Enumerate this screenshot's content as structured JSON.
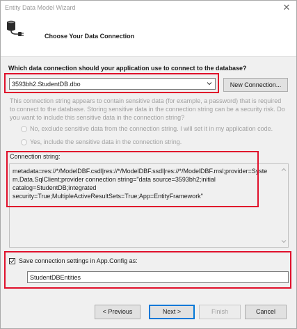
{
  "window": {
    "title": "Entity Data Model Wizard",
    "close_glyph": "✕"
  },
  "header": {
    "title": "Choose Your Data Connection",
    "icon": "database-plug-icon"
  },
  "question": "Which data connection should your application use to connect to the database?",
  "connection": {
    "selected": "3593bh2.StudentDB.dbo",
    "new_button": "New Connection..."
  },
  "sensitive": {
    "text": "This connection string appears to contain sensitive data (for example, a password) that is required to connect to the database. Storing sensitive data in the connection string can be a security risk. Do you want to include this sensitive data in the connection string?",
    "option_no": "No, exclude sensitive data from the connection string. I will set it in my application code.",
    "option_yes": "Yes, include the sensitive data in the connection string."
  },
  "conn_string": {
    "label": "Connection string:",
    "value": "metadata=res://*/ModelDBF.csdl|res://*/ModelDBF.ssdl|res://*/ModelDBF.msl;provider=System.Data.SqlClient;provider connection string=\"data source=3593bh2;initial catalog=StudentDB;integrated security=True;MultipleActiveResultSets=True;App=EntityFramework\""
  },
  "save": {
    "checked": true,
    "label": "Save connection settings in App.Config as:",
    "name": "StudentDBEntities"
  },
  "buttons": {
    "previous": "< Previous",
    "next": "Next >",
    "finish": "Finish",
    "cancel": "Cancel"
  },
  "colors": {
    "highlight": "#e0102b",
    "default_button_border": "#0078d7"
  }
}
